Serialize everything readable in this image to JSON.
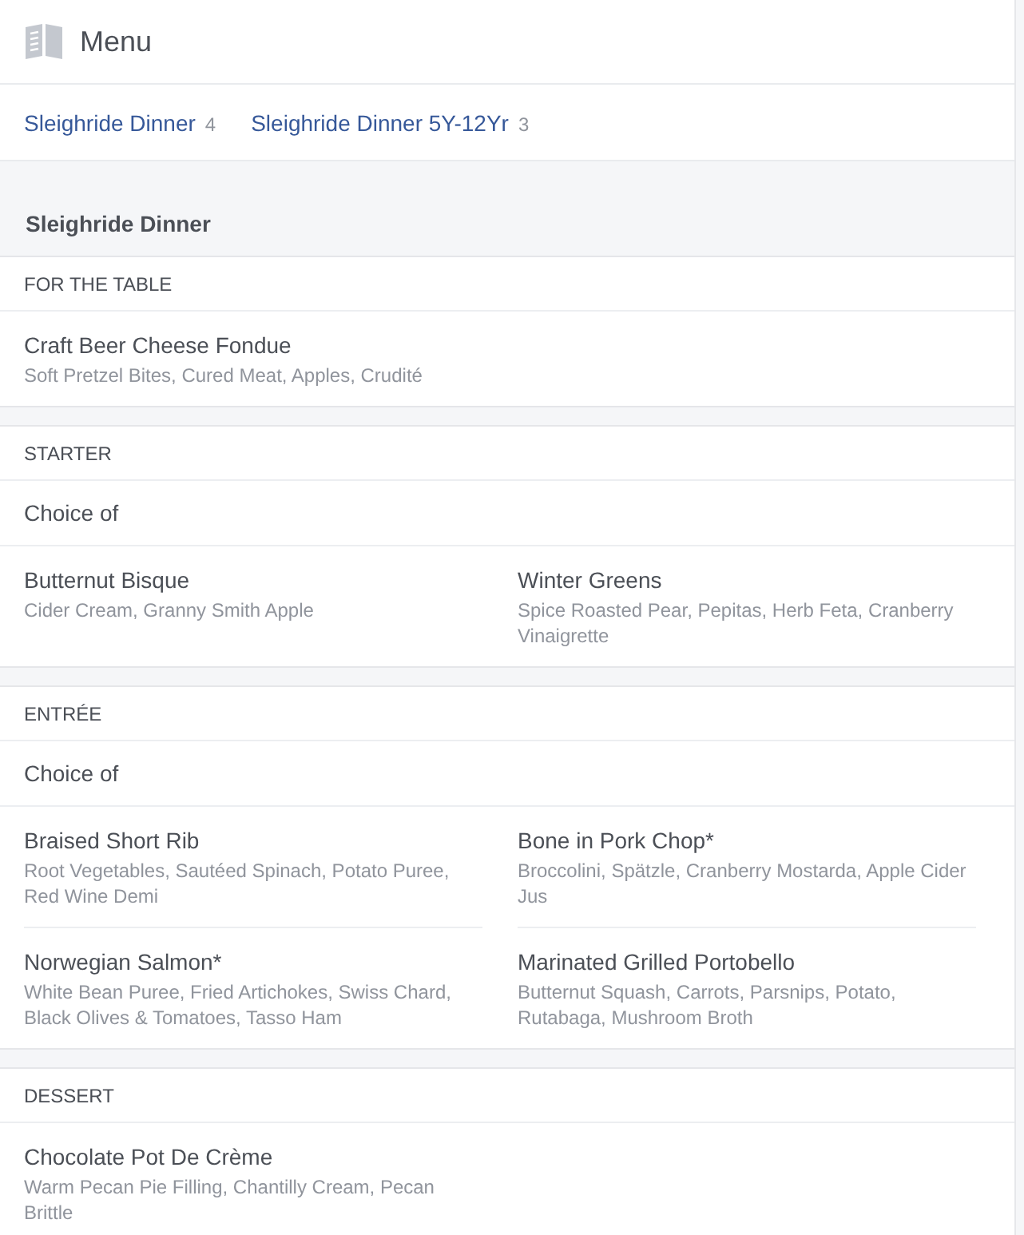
{
  "header": {
    "title": "Menu"
  },
  "menu_tabs": [
    {
      "label": "Sleighride Dinner",
      "count": "4"
    },
    {
      "label": "Sleighride Dinner 5Y-12Yr",
      "count": "3"
    }
  ],
  "menu": {
    "title": "Sleighride Dinner",
    "sections": [
      {
        "title": "FOR THE TABLE",
        "items": [
          {
            "name": "Craft Beer Cheese Fondue",
            "description": "Soft Pretzel Bites, Cured Meat, Apples, Crudité"
          }
        ]
      },
      {
        "title": "STARTER",
        "note": "Choice of",
        "items": [
          {
            "name": "Butternut Bisque",
            "description": "Cider Cream, Granny Smith Apple"
          },
          {
            "name": "Winter Greens",
            "description": "Spice Roasted Pear, Pepitas, Herb Feta, Cranberry Vinaigrette"
          }
        ]
      },
      {
        "title": "ENTRÉE",
        "note": "Choice of",
        "items": [
          {
            "name": "Braised Short Rib",
            "description": "Root Vegetables, Sautéed Spinach, Potato Puree, Red Wine Demi"
          },
          {
            "name": "Bone in Pork Chop*",
            "description": "Broccolini, Spätzle, Cranberry Mostarda, Apple Cider Jus"
          },
          {
            "name": "Norwegian Salmon*",
            "description": "White Bean Puree, Fried Artichokes, Swiss Chard, Black Olives & Tomatoes, Tasso Ham"
          },
          {
            "name": "Marinated Grilled Portobello",
            "description": "Butternut Squash, Carrots, Parsnips, Potato, Rutabaga, Mushroom Broth"
          }
        ]
      },
      {
        "title": "DESSERT",
        "items": [
          {
            "name": "Chocolate Pot De Crème",
            "description": "Warm Pecan Pie Filling, Chantilly Cream, Pecan Brittle"
          }
        ]
      }
    ]
  }
}
